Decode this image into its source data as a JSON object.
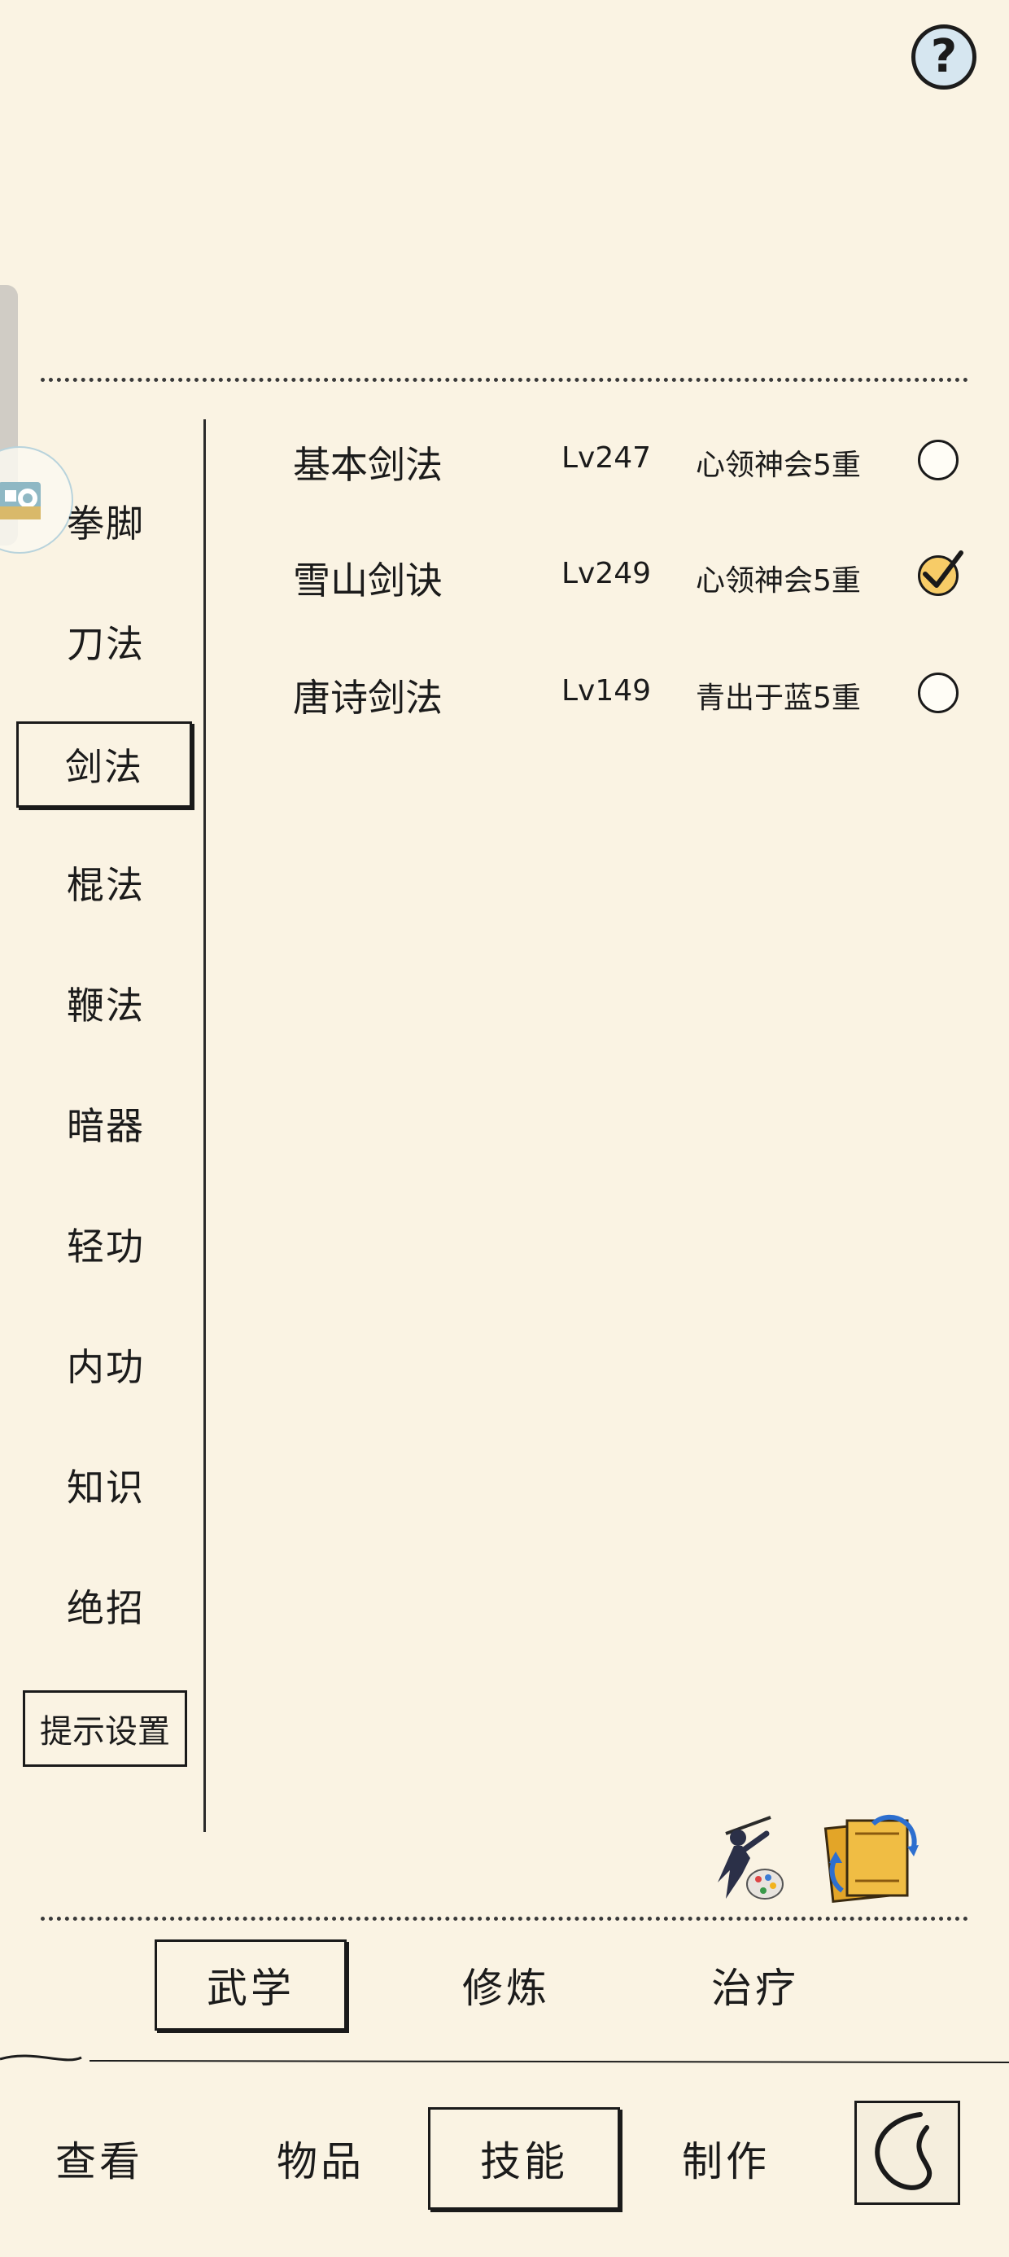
{
  "help": {
    "icon": "question-icon",
    "label": "?"
  },
  "sidebar": {
    "categories": [
      {
        "label": "拳脚"
      },
      {
        "label": "刀法"
      },
      {
        "label": "剑法",
        "active": true
      },
      {
        "label": "棍法"
      },
      {
        "label": "鞭法"
      },
      {
        "label": "暗器"
      },
      {
        "label": "轻功"
      },
      {
        "label": "内功"
      },
      {
        "label": "知识"
      },
      {
        "label": "绝招"
      }
    ],
    "tip_settings_label": "提示设置"
  },
  "skills": [
    {
      "name": "基本剑法",
      "level": "Lv247",
      "rank": "心领神会5重",
      "equipped": false
    },
    {
      "name": "雪山剑诀",
      "level": "Lv249",
      "rank": "心领神会5重",
      "equipped": true
    },
    {
      "name": "唐诗剑法",
      "level": "Lv149",
      "rank": "青出于蓝5重",
      "equipped": false
    }
  ],
  "tools": [
    {
      "icon": "swordsman-palette-icon"
    },
    {
      "icon": "book-swap-icon"
    }
  ],
  "subtabs": [
    {
      "label": "武学",
      "active": true
    },
    {
      "label": "修炼",
      "active": false
    },
    {
      "label": "治疗",
      "active": false
    }
  ],
  "nav": {
    "tabs": [
      {
        "label": "查看",
        "active": false
      },
      {
        "label": "物品",
        "active": false
      },
      {
        "label": "技能",
        "active": true
      },
      {
        "label": "制作",
        "active": false
      }
    ],
    "back_icon": "back-arrow-icon"
  },
  "colors": {
    "background": "#faf3e3",
    "ink": "#1b1b1b",
    "check_fill": "#f7cc67",
    "help_fill": "#d6e6f0"
  }
}
